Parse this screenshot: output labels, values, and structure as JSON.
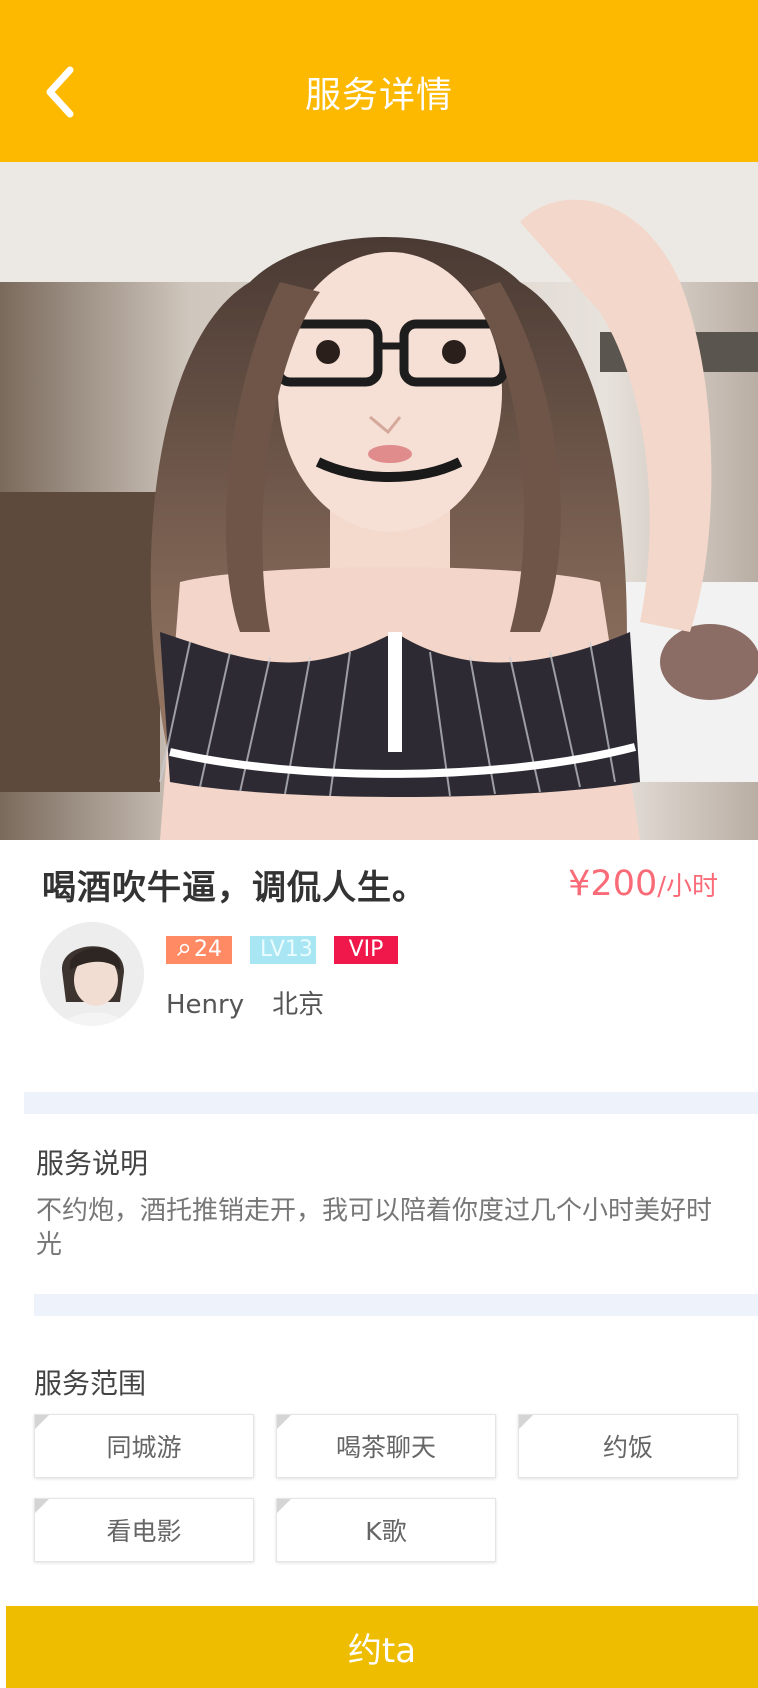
{
  "header": {
    "title": "服务详情",
    "back_icon": "chevron-left-icon"
  },
  "colors": {
    "accent": "#fdb800",
    "cta": "#eebd00",
    "price": "#fa6b78",
    "vip": "#f0174b",
    "fans_badge": "#ff8a63",
    "level_badge": "#a7e6f2"
  },
  "service": {
    "title": "喝酒吹牛逼，调侃人生。",
    "price_amount": "¥200",
    "price_unit": "/小时"
  },
  "user": {
    "fans_count": "24",
    "level": "LV13",
    "vip": "VIP",
    "name": "Henry",
    "city": "北京"
  },
  "description": {
    "label": "服务说明",
    "text": "不约炮，酒托推销走开，我可以陪着你度过几个小时美好时光"
  },
  "scope": {
    "label": "服务范围",
    "tags": [
      "同城游",
      "喝茶聊天",
      "约饭",
      "看电影",
      "K歌"
    ]
  },
  "cta": {
    "label": "约ta"
  }
}
